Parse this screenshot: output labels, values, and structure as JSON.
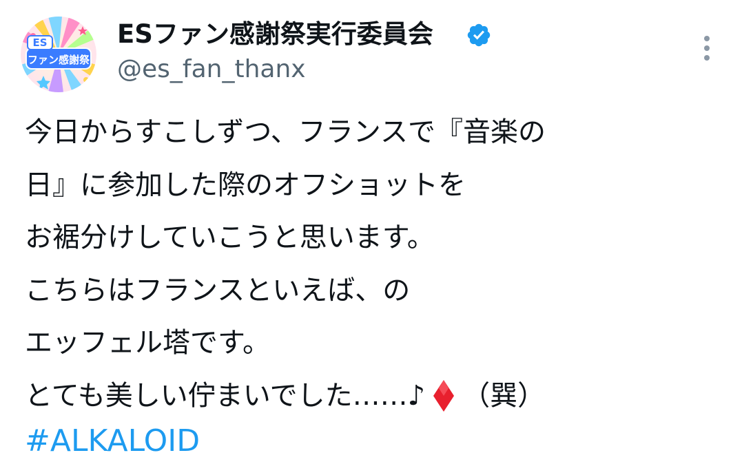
{
  "author": {
    "display_name": "ESファン感謝祭実行委員会",
    "handle": "@es_fan_thanx",
    "verified": true,
    "avatar_text": "ESファン感謝祭"
  },
  "tweet": {
    "lines": [
      "今日からすこしずつ、フランスで『音楽の",
      "日』に参加した際のオフショットを",
      "お裾分けしていこうと思います。",
      "こちらはフランスといえば、の",
      "エッフェル塔です。"
    ],
    "last_line_before": "とても美しい佇まいでした……♪",
    "last_line_icon": "red-diamond-icon",
    "last_line_after": "（巽）",
    "hashtag": "#ALKALOID"
  },
  "icons": {
    "verified": "verified-badge-icon",
    "more": "more-vertical-icon"
  },
  "colors": {
    "link": "#1d9bf0",
    "verified": "#1d9bf0",
    "secondary_text": "#536471",
    "diamond": "#e8202e"
  }
}
